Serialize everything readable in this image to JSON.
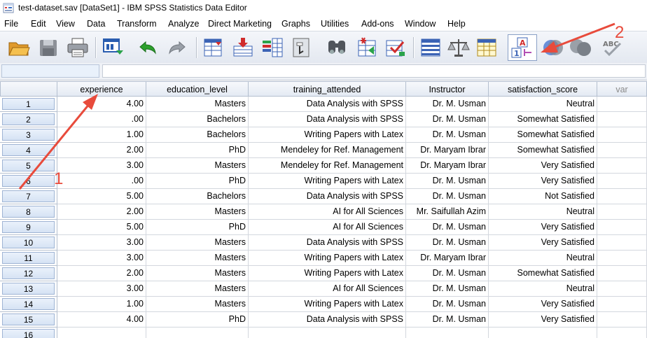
{
  "window": {
    "title": "test-dataset.sav [DataSet1] - IBM SPSS Statistics Data Editor"
  },
  "menu": [
    "File",
    "Edit",
    "View",
    "Data",
    "Transform",
    "Analyze",
    "Direct Marketing",
    "Graphs",
    "Utilities",
    "Add-ons",
    "Window",
    "Help"
  ],
  "toolbar_icons": [
    "open-folder-icon",
    "save-icon",
    "print-icon",
    "recall-dialog-icon",
    "undo-icon",
    "redo-icon",
    "goto-case-icon",
    "goto-variable-icon",
    "variables-icon",
    "run-descriptives-icon",
    "find-icon",
    "insert-cases-icon",
    "insert-variable-icon",
    "split-file-icon",
    "weight-cases-icon",
    "select-cases-icon",
    "value-labels-icon",
    "use-sets-icon",
    "show-all-variables-icon",
    "spelling-icon"
  ],
  "cell_editor": {
    "reference": "",
    "value": ""
  },
  "columns": [
    "experience",
    "education_level",
    "training_attended",
    "Instructor",
    "satisfaction_score",
    "var"
  ],
  "rows": [
    {
      "n": "1",
      "c": [
        "4.00",
        "Masters",
        "Data Analysis with SPSS",
        "Dr. M. Usman",
        "Neutral",
        ""
      ]
    },
    {
      "n": "2",
      "c": [
        ".00",
        "Bachelors",
        "Data Analysis with SPSS",
        "Dr. M. Usman",
        "Somewhat Satisfied",
        ""
      ]
    },
    {
      "n": "3",
      "c": [
        "1.00",
        "Bachelors",
        "Writing Papers with Latex",
        "Dr. M. Usman",
        "Somewhat Satisfied",
        ""
      ]
    },
    {
      "n": "4",
      "c": [
        "2.00",
        "PhD",
        "Mendeley for Ref. Management",
        "Dr. Maryam Ibrar",
        "Somewhat Satisfied",
        ""
      ]
    },
    {
      "n": "5",
      "c": [
        "3.00",
        "Masters",
        "Mendeley for Ref. Management",
        "Dr. Maryam Ibrar",
        "Very Satisfied",
        ""
      ]
    },
    {
      "n": "6",
      "c": [
        ".00",
        "PhD",
        "Writing Papers with Latex",
        "Dr. M. Usman",
        "Very Satisfied",
        ""
      ]
    },
    {
      "n": "7",
      "c": [
        "5.00",
        "Bachelors",
        "Data Analysis with SPSS",
        "Dr. M. Usman",
        "Not Satisfied",
        ""
      ]
    },
    {
      "n": "8",
      "c": [
        "2.00",
        "Masters",
        "AI for All Sciences",
        "Mr. Saifullah Azim",
        "Neutral",
        ""
      ]
    },
    {
      "n": "9",
      "c": [
        "5.00",
        "PhD",
        "AI for All Sciences",
        "Dr. M. Usman",
        "Very Satisfied",
        ""
      ]
    },
    {
      "n": "10",
      "c": [
        "3.00",
        "Masters",
        "Data Analysis with SPSS",
        "Dr. M. Usman",
        "Very Satisfied",
        ""
      ]
    },
    {
      "n": "11",
      "c": [
        "3.00",
        "Masters",
        "Writing Papers with Latex",
        "Dr. Maryam Ibrar",
        "Neutral",
        ""
      ]
    },
    {
      "n": "12",
      "c": [
        "2.00",
        "Masters",
        "Writing Papers with Latex",
        "Dr. M. Usman",
        "Somewhat Satisfied",
        ""
      ]
    },
    {
      "n": "13",
      "c": [
        "3.00",
        "Masters",
        "AI for All Sciences",
        "Dr. M. Usman",
        "Neutral",
        ""
      ]
    },
    {
      "n": "14",
      "c": [
        "1.00",
        "Masters",
        "Writing Papers with Latex",
        "Dr. M. Usman",
        "Very Satisfied",
        ""
      ]
    },
    {
      "n": "15",
      "c": [
        "4.00",
        "PhD",
        "Data Analysis with SPSS",
        "Dr. M. Usman",
        "Very Satisfied",
        ""
      ]
    },
    {
      "n": "16",
      "c": [
        "",
        "",
        "",
        "",
        "",
        ""
      ]
    }
  ],
  "annotations": {
    "label_1": "1",
    "label_2": "2",
    "color": "#e84b3c"
  }
}
